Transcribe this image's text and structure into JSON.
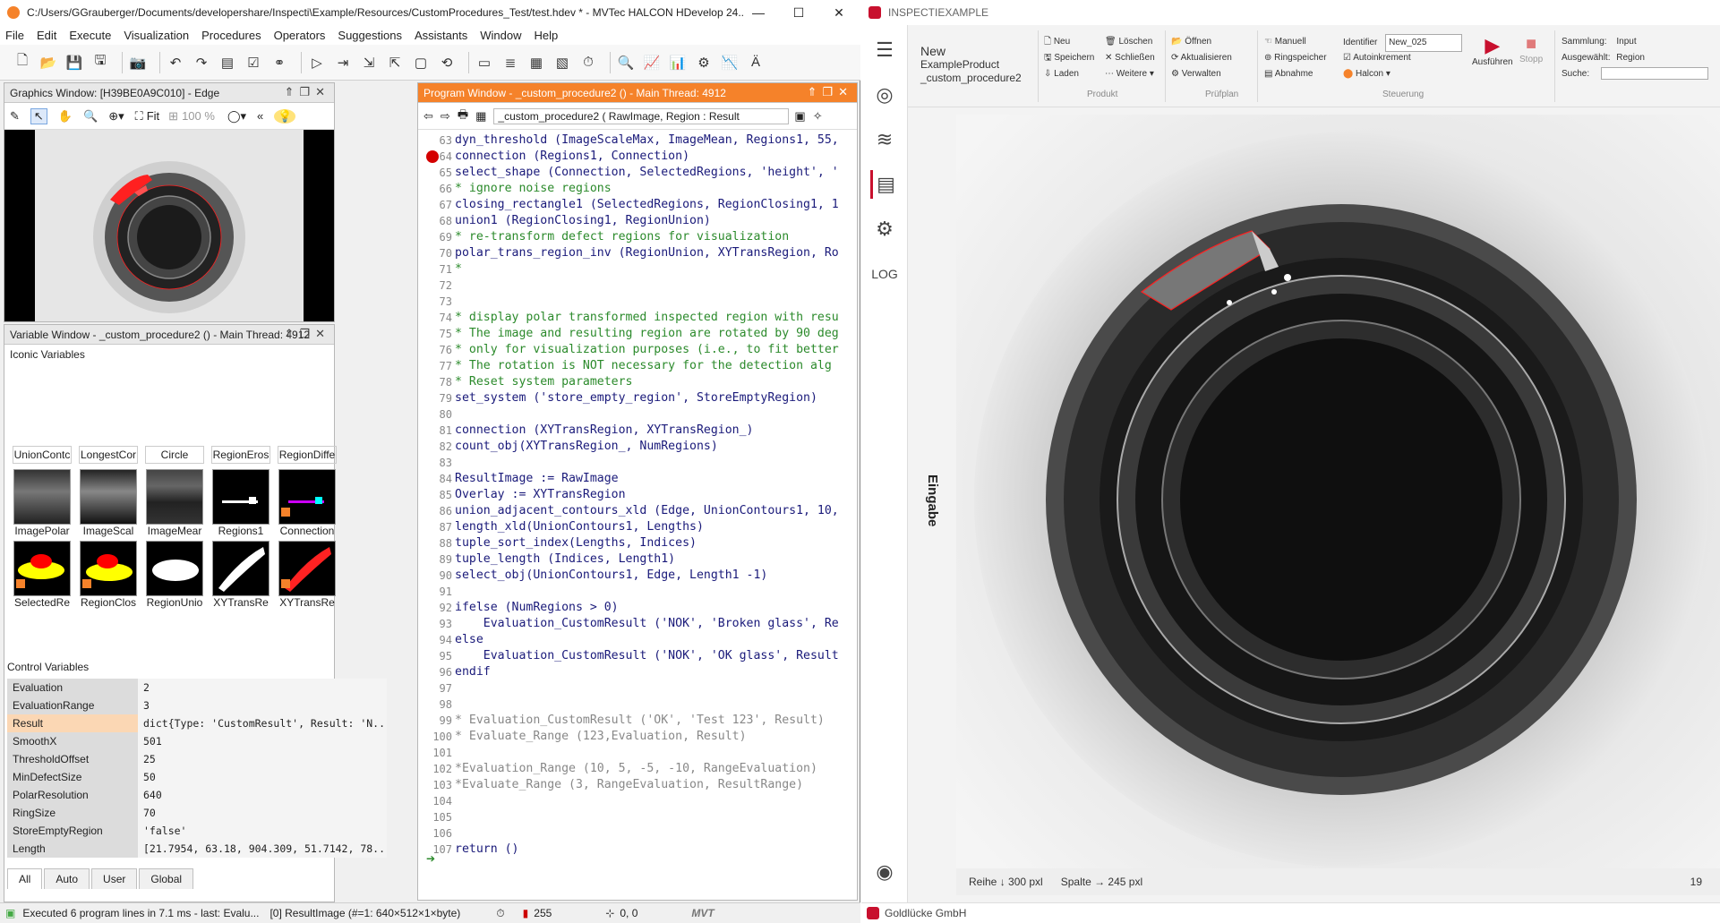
{
  "hdevelop": {
    "title": "C:/Users/GGrauberger/Documents/developershare/Inspecti\\Example/Resources/CustomProcedures_Test/test.hdev * - MVTec HALCON HDevelop 24....",
    "menu": [
      "File",
      "Edit",
      "Execute",
      "Visualization",
      "Procedures",
      "Operators",
      "Suggestions",
      "Assistants",
      "Window",
      "Help"
    ],
    "graphics": {
      "header": "Graphics Window: [H39BE0A9C010] - Edge",
      "fit_label": "Fit",
      "zoom": "100 %"
    },
    "program": {
      "header": "Program Window - _custom_procedure2 () - Main Thread: 4912",
      "procedure_selector": "_custom_procedure2 ( RawImage, Region : Result",
      "lines": [
        {
          "no": "63",
          "text": "dyn_threshold (ImageScaleMax, ImageMean, Regions1, 55,",
          "style": "code"
        },
        {
          "no": "64",
          "text": "connection (Regions1, Connection)",
          "style": "code"
        },
        {
          "no": "65",
          "text": "select_shape (Connection, SelectedRegions, 'height', '",
          "style": "code"
        },
        {
          "no": "66",
          "text": "* ignore noise regions",
          "style": "comment"
        },
        {
          "no": "67",
          "text": "closing_rectangle1 (SelectedRegions, RegionClosing1, 1",
          "style": "code"
        },
        {
          "no": "68",
          "text": "union1 (RegionClosing1, RegionUnion)",
          "style": "code"
        },
        {
          "no": "69",
          "text": "* re-transform defect regions for visualization",
          "style": "comment"
        },
        {
          "no": "70",
          "text": "polar_trans_region_inv (RegionUnion, XYTransRegion, Ro",
          "style": "code"
        },
        {
          "no": "71",
          "text": "*",
          "style": "comment"
        },
        {
          "no": "72",
          "text": "",
          "style": "code"
        },
        {
          "no": "73",
          "text": "",
          "style": "code"
        },
        {
          "no": "74",
          "text": "* display polar transformed inspected region with resu",
          "style": "comment"
        },
        {
          "no": "75",
          "text": "* The image and resulting region are rotated by 90 deg",
          "style": "comment"
        },
        {
          "no": "76",
          "text": "* only for visualization purposes (i.e., to fit better",
          "style": "comment"
        },
        {
          "no": "77",
          "text": "* The rotation is NOT necessary for the detection alg",
          "style": "comment"
        },
        {
          "no": "78",
          "text": "* Reset system parameters",
          "style": "comment"
        },
        {
          "no": "79",
          "text": "set_system ('store_empty_region', StoreEmptyRegion)",
          "style": "code"
        },
        {
          "no": "80",
          "text": "",
          "style": "code"
        },
        {
          "no": "81",
          "text": "connection (XYTransRegion, XYTransRegion_)",
          "style": "code"
        },
        {
          "no": "82",
          "text": "count_obj(XYTransRegion_, NumRegions)",
          "style": "code"
        },
        {
          "no": "83",
          "text": "",
          "style": "code"
        },
        {
          "no": "84",
          "text": "ResultImage := RawImage",
          "style": "code"
        },
        {
          "no": "85",
          "text": "Overlay := XYTransRegion",
          "style": "code"
        },
        {
          "no": "86",
          "text": "union_adjacent_contours_xld (Edge, UnionContours1, 10,",
          "style": "code"
        },
        {
          "no": "87",
          "text": "length_xld(UnionContours1, Lengths)",
          "style": "code"
        },
        {
          "no": "88",
          "text": "tuple_sort_index(Lengths, Indices)",
          "style": "code"
        },
        {
          "no": "89",
          "text": "tuple_length (Indices, Length1)",
          "style": "code"
        },
        {
          "no": "90",
          "text": "select_obj(UnionContours1, Edge, Length1 -1)",
          "style": "code"
        },
        {
          "no": "91",
          "text": "",
          "style": "code"
        },
        {
          "no": "92",
          "text": "ifelse (NumRegions > 0)",
          "style": "code"
        },
        {
          "no": "93",
          "text": "    Evaluation_CustomResult ('NOK', 'Broken glass', Re",
          "style": "code"
        },
        {
          "no": "94",
          "text": "else",
          "style": "code"
        },
        {
          "no": "95",
          "text": "    Evaluation_CustomResult ('NOK', 'OK glass', Result",
          "style": "code"
        },
        {
          "no": "96",
          "text": "endif",
          "style": "code"
        },
        {
          "no": "97",
          "text": "",
          "style": "code"
        },
        {
          "no": "98",
          "text": "",
          "style": "code"
        },
        {
          "no": "99",
          "text": "* Evaluation_CustomResult ('OK', 'Test 123', Result)",
          "style": "gray"
        },
        {
          "no": "100",
          "text": "* Evaluate_Range (123,Evaluation, Result)",
          "style": "gray"
        },
        {
          "no": "101",
          "text": "",
          "style": "code"
        },
        {
          "no": "102",
          "text": "*Evaluation_Range (10, 5, -5, -10, RangeEvaluation)",
          "style": "gray"
        },
        {
          "no": "103",
          "text": "*Evaluate_Range (3, RangeEvaluation, ResultRange)",
          "style": "gray"
        },
        {
          "no": "104",
          "text": "",
          "style": "code"
        },
        {
          "no": "105",
          "text": "",
          "style": "code"
        },
        {
          "no": "106",
          "text": "",
          "style": "code"
        },
        {
          "no": "107",
          "text": "return ()",
          "style": "code"
        }
      ]
    },
    "variables": {
      "header": "Variable Window - _custom_procedure2 () - Main Thread: 4912",
      "iconic_title": "Iconic Variables",
      "iconic_names": [
        "UnionContc",
        "LongestCor",
        "Circle",
        "RegionEros",
        "RegionDiffe",
        "ImagePolar",
        "ImageScal",
        "ImageMear",
        "Regions1",
        "Connection",
        "SelectedRe",
        "RegionClos",
        "RegionUnio",
        "XYTransRe",
        "XYTransRe"
      ],
      "control_title": "Control Variables",
      "control": [
        {
          "name": "Evaluation",
          "value": "2"
        },
        {
          "name": "EvaluationRange",
          "value": "3"
        },
        {
          "name": "Result",
          "value": "dict{Type: 'CustomResult', Result: 'N..."
        },
        {
          "name": "SmoothX",
          "value": "501"
        },
        {
          "name": "ThresholdOffset",
          "value": "25"
        },
        {
          "name": "MinDefectSize",
          "value": "50"
        },
        {
          "name": "PolarResolution",
          "value": "640"
        },
        {
          "name": "RingSize",
          "value": "70"
        },
        {
          "name": "StoreEmptyRegion",
          "value": "'false'"
        },
        {
          "name": "Length",
          "value": "[21.7954, 63.18, 904.309, 51.7142, 78..."
        }
      ],
      "tabs": [
        "All",
        "Auto",
        "User",
        "Global"
      ]
    },
    "status": {
      "message": "Executed 6 program lines in 7.1 ms - last: Evalu...",
      "image_info": "[0] ResultImage (#=1: 640×512×1×byte)",
      "gray_value": "255",
      "coords": "0, 0"
    }
  },
  "inspecti": {
    "title": "INSPECTIEXAMPLE",
    "product": {
      "status": "New",
      "name": "ExampleProduct",
      "procedure": "_custom_procedure2"
    },
    "ribbon": {
      "produkt": {
        "label": "Produkt",
        "items": [
          "Neu",
          "Löschen",
          "Speichern",
          "Schließen",
          "Laden",
          "Weitere"
        ]
      },
      "pruefplan": {
        "label": "Prüfplan",
        "items": [
          "Öffnen",
          "Aktualisieren",
          "Verwalten"
        ]
      },
      "steuerung": {
        "label": "Steuerung",
        "items": [
          "Manuell",
          "Ringspeicher",
          "Abnahme",
          "Identifier",
          "Autoinkrement",
          "Halcon"
        ],
        "identifier_value": "New_025",
        "run": "Ausführen",
        "stop": "Stopp"
      },
      "info": {
        "sammlung_label": "Sammlung:",
        "sammlung_value": "Input",
        "ausgewaehlt_label": "Ausgewählt:",
        "ausgewaehlt_value": "Region",
        "suche_label": "Suche:"
      }
    },
    "side_label": "Eingabe",
    "image_status": {
      "row": "Reihe ↓ 300 pxl",
      "col": "Spalte → 245 pxl",
      "count": "19"
    },
    "company": "Goldlücke GmbH"
  },
  "colors": {
    "accent_orange": "#f5822a",
    "breakpoint": "#d40000",
    "brand_red": "#c8102e",
    "overlay_red": "#ff2020"
  }
}
